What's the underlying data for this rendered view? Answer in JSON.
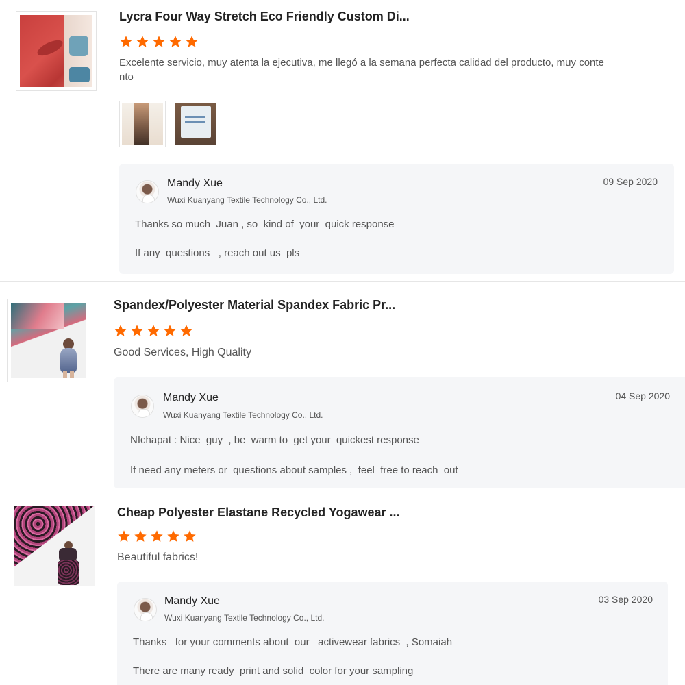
{
  "reviews": [
    {
      "title": "Lycra Four Way Stretch Eco Friendly Custom Di...",
      "rating": 5,
      "comment_line1": "Excelente servicio, muy atenta la ejecutiva, me llegó a la semana perfecta calidad del producto, muy conte",
      "comment_line2": "nto",
      "photos": [
        "photo-1",
        "photo-2"
      ],
      "reply": {
        "name": "Mandy Xue",
        "company": "Wuxi Kuanyang Textile Technology Co., Ltd.",
        "date": "09 Sep 2020",
        "line1": "Thanks so much  Juan , so  kind of  your  quick response",
        "line2": "If any  questions   , reach out us  pls"
      }
    },
    {
      "title": "Spandex/Polyester Material Spandex Fabric Pr...",
      "rating": 5,
      "comment_line1": "Good Services, High Quality",
      "reply": {
        "name": "Mandy Xue",
        "company": "Wuxi Kuanyang Textile Technology Co., Ltd.",
        "date": "04 Sep 2020",
        "line1": "NIchapat : Nice  guy  , be  warm to  get your  quickest response",
        "line2": "If need any meters or  questions about samples ,  feel  free to reach  out"
      }
    },
    {
      "title": "Cheap Polyester Elastane Recycled Yogawear ...",
      "rating": 5,
      "comment_line1": "Beautiful fabrics!",
      "reply": {
        "name": "Mandy Xue",
        "company": "Wuxi Kuanyang Textile Technology Co., Ltd.",
        "date": "03 Sep 2020",
        "line1": "Thanks   for your comments about  our   activewear fabrics  , Somaiah",
        "line2": "There are many ready  print and solid  color for your sampling"
      }
    }
  ],
  "colors": {
    "star": "#ff6a00",
    "reply_bg": "#f5f6f8"
  }
}
